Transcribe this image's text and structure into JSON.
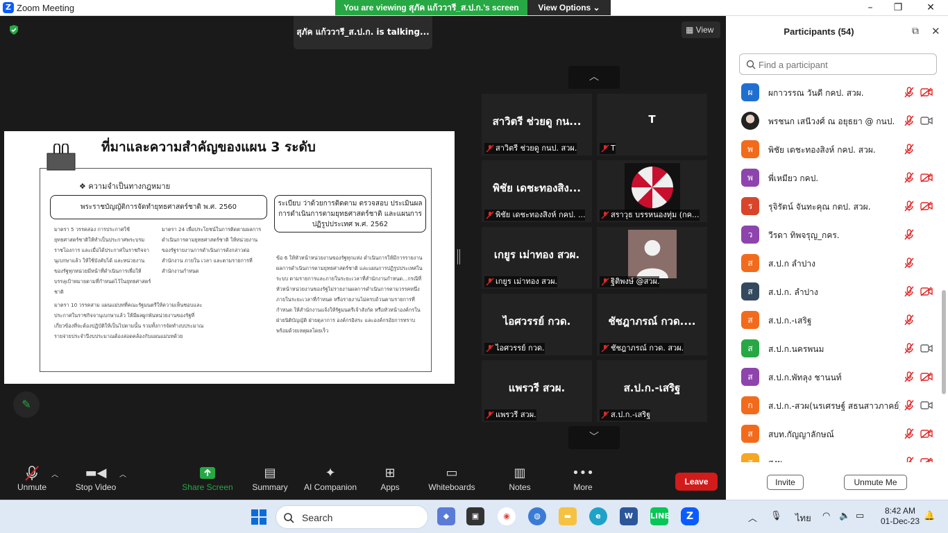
{
  "window": {
    "title": "Zoom Meeting",
    "controls": [
      "–",
      "❐",
      "✕"
    ]
  },
  "banner": {
    "text": "You are viewing สุภัค แก้ววารี_ส.ป.ก.'s screen",
    "options": "View Options ⌄"
  },
  "meeting": {
    "talking": "สุภัค แก้ววารี_ส.ป.ก. is talking...",
    "view_label": "View"
  },
  "slide": {
    "title": "ที่มาและความสำคัญของแผน 3 ระดับ",
    "need": "❖  ความจำเป็นทางกฎหมาย",
    "box_left": "พระราชบัญญัติการจัดทำยุทธศาสตร์ชาติ พ.ศ. 2560",
    "box_right": "ระเบียบ ว่าด้วยการติดตาม ตรวจสอบ ประเมินผล การดำเนินการตามยุทธศาสตร์ชาติ และแผนการปฏิรูปประเทศ พ.ศ. 2562",
    "para1": "มาตรา 5 วรรคสอง การประกาศใช้ยุทธศาสตร์ชาติให้ทำเป็นประกาศพระบรมราชโองการ และเมื่อได้ประกาศในราชกิจจานุเบกษาแล้ว ให้ใช้บังคับได้ และหน่วยงานของรัฐทุกหน่วยมีหน้าที่ดำเนินการเพื่อให้บรรลุเป้าหมายตามที่กำหนดไว้ในยุทธศาสตร์ชาติ",
    "para2": "มาตรา 24 เพื่อประโยชน์ในการติดตามผลการดำเนินการตามยุทธศาสตร์ชาติ ให้หน่วยงานของรัฐรายงานการดำเนินการดังกล่าวต่อสำนักงาน ภายใน เวลา และตามรายการที่สำนักงานกำหนด",
    "para3": "มาตรา 10 วรรคสาม แผนแม่บทที่คณะรัฐมนตรีให้ความเห็นชอบและประกาศในราชกิจจานุเบกษาแล้ว ให้มีผลผูกพันหน่วยงานของรัฐที่เกี่ยวข้องที่จะต้องปฏิบัติให้เป็นไปตามนั้น รวมทั้งการจัดทำงบประมาณรายจ่ายประจำปีงบประมาณต้องสอดคล้องกับแผนแม่บทด้วย",
    "para4": "ข้อ 6 ให้หัวหน้าหน่วยงานของรัฐทุกแห่ง ดำเนินการให้มีการรายงานผลการดำเนินการตามยุทธศาสตร์ชาติ และแผนการปฏิรูปประเทศในระบบ ตามรายการและภายในระยะเวลาที่สำนักงานกำหนด...กรณีที่หัวหน้าหน่วยงานของรัฐไม่รายงานผลการดำเนินการตามวรรคหนึ่งภายในระยะเวลาที่กำหนด หรือรายงานไม่ครบถ้วนตามรายการที่กำหนด ให้สำนักงานแจ้งให้รัฐมนตรีเจ้าสังกัด หรือหัวหน้าองค์กรในฝ่ายนิติบัญญัติ ฝ่ายตุลาการ องค์กรอิสระ และองค์กรอัยการทราบ พร้อมด้วยเหตุผลโดยเร็ว"
  },
  "tiles": [
    {
      "big": "สาวิตรี ช่วยดู กน...",
      "label": "สาวิตรี ช่วยดู กนป. สวผ."
    },
    {
      "big": "T",
      "label": "T"
    },
    {
      "big": "พิชัย เดชะทองสิง...",
      "label": "พิชัย เดชะทองสิงห์ กคป. ..."
    },
    {
      "big": "",
      "label": "สราวุธ บรรหนองทุ่ม (กค..."
    },
    {
      "big": "เกยูร เม่าทอง สวผ.",
      "label": "เกยูร เม่าทอง สวผ."
    },
    {
      "big": "",
      "label": "ฐิติพงษ์ @สวผ."
    },
    {
      "big": "ไอศวรรย์ กวด.",
      "label": "ไอศวรรย์ กวด."
    },
    {
      "big": "ชัชฎาภรณ์   กวด....",
      "label": "ชัชฎาภรณ์   กวด. สวผ."
    },
    {
      "big": "แพรวรี สวผ.",
      "label": "แพรวรี สวผ."
    },
    {
      "big": "ส.ป.ก.-เสริฐ",
      "label": "ส.ป.ก.-เสริฐ"
    }
  ],
  "toolbar": {
    "unmute": "Unmute",
    "stop_video": "Stop Video",
    "share": "Share Screen",
    "summary": "Summary",
    "ai": "AI Companion",
    "apps": "Apps",
    "whiteboards": "Whiteboards",
    "notes": "Notes",
    "more": "More",
    "leave": "Leave"
  },
  "panel": {
    "title": "Participants (54)",
    "search_placeholder": "Find a participant",
    "invite": "Invite",
    "unmute_me": "Unmute Me",
    "participants": [
      {
        "initial": "ผ",
        "name": "ผกาวรรณ วันดี กคป. สวผ.",
        "color": "#1f6fd1",
        "cam": "off"
      },
      {
        "initial": "",
        "name": "พรชนก เสนีวงศ์ ณ อยุธยา @ กนป.",
        "color": "#333",
        "cam": "on"
      },
      {
        "initial": "พ",
        "name": "พิชัย เดชะทองสิงห์ กคป. สวผ.",
        "color": "#f26b1d",
        "cam": "none"
      },
      {
        "initial": "พ",
        "name": "พี่เหมียว กคป.",
        "color": "#8e44ad",
        "cam": "off"
      },
      {
        "initial": "ร",
        "name": "รุจิรัตน์ จันทะคุณ กตป. สวผ.",
        "color": "#d9452b",
        "cam": "off"
      },
      {
        "initial": "ว",
        "name": "วีรดา ทิพจรุญ_กคร.",
        "color": "#8e44ad",
        "cam": "none"
      },
      {
        "initial": "ส",
        "name": "ส.ป.ก ลำปาง",
        "color": "#f26b1d",
        "cam": "none"
      },
      {
        "initial": "ส",
        "name": "ส.ป.ก. ลำปาง",
        "color": "#34495e",
        "cam": "off"
      },
      {
        "initial": "ส",
        "name": "ส.ป.ก.-เสริฐ",
        "color": "#f26b1d",
        "cam": "none"
      },
      {
        "initial": "ส",
        "name": "ส.ป.ก.นครพนม",
        "color": "#27a844",
        "cam": "on"
      },
      {
        "initial": "ส",
        "name": "ส.ป.ก.พัทลุง ชานนท์",
        "color": "#8e44ad",
        "cam": "off"
      },
      {
        "initial": "ก",
        "name": "ส.ป.ก.-สวผ(นรเศรษฐ์ สธนสาวภาคย์)",
        "color": "#f26b1d",
        "cam": "on"
      },
      {
        "initial": "ส",
        "name": "สบท.กัญญาลักษณ์",
        "color": "#f26b1d",
        "cam": "off"
      },
      {
        "initial": "ส",
        "name": "สงผ",
        "color": "#f5a623",
        "cam": "off"
      }
    ]
  },
  "taskbar": {
    "search": "Search",
    "lang": "ไทย",
    "time": "8:42 AM",
    "date": "01-Dec-23"
  }
}
